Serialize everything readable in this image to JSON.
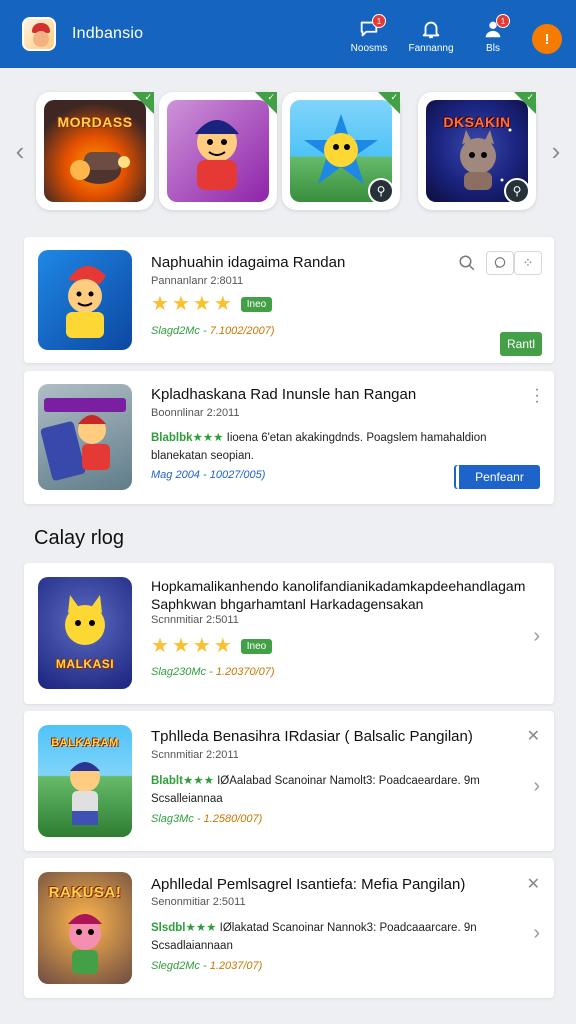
{
  "header": {
    "title": "Indbansio",
    "actions": [
      {
        "label": "Noosms",
        "icon": "chat-icon",
        "badge": "1"
      },
      {
        "label": "Fannanng",
        "icon": "bell-icon",
        "badge": ""
      },
      {
        "label": "Bls",
        "icon": "person-icon",
        "badge": "1"
      }
    ],
    "profile_initial": "!"
  },
  "carousel": {
    "items": [
      {
        "title": "MORDASS",
        "icon": "game-art-icon"
      },
      {
        "title": "",
        "icon": "pirate-character-icon"
      },
      {
        "title": "",
        "icon": "star-character-icon"
      },
      {
        "title": "DKSAKIN",
        "icon": "space-cat-icon"
      }
    ]
  },
  "top_cards": [
    {
      "title": "Naphuahin idagaima Randan",
      "subtitle": "Pannanlanr 2:8011",
      "rating_badge": "Ineo",
      "meta_prefix": "Slagd2Mc",
      "meta_sep": " - ",
      "meta_value": "7.1002/2007)",
      "action_label": "Rantl"
    },
    {
      "title": "Kpladhaskana Rad Inunsle han Rangan",
      "subtitle": "Boonnlinar 2:2011",
      "desc_prefix": "Blablbk★★★",
      "desc_line1": " Iioena 6'etan akakingdnds. Poagslem hamahaldion",
      "desc_line2": "blanekatan seopian.",
      "meta_prefix": "Mag 2004",
      "meta_sep": " - ",
      "meta_value": "10027/005)",
      "action_label": "Penfeanr"
    }
  ],
  "section": {
    "title": "Calay rlog"
  },
  "list_cards": [
    {
      "title": "Hopkamalikanhendo kanolifandianikadamkapdeehandlagam",
      "title2": "Saphkwan bhgarhamtanl Harkadagensakan",
      "subtitle": "Scnnmitiar 2:5011",
      "rating_badge": "Ineo",
      "meta_prefix": "Slag230Mc",
      "meta_sep": " - ",
      "meta_value": "1.20370/07)",
      "art_title": "MALKASI"
    },
    {
      "title": "Tphlleda Benasihra IRdasiar ( Balsalic Pangilan)",
      "subtitle": "Scnnmitiar 2:2011",
      "desc_prefix": "Blablt★★★",
      "desc_line1": " IØAalabad Scanoinar Namolt3: Poadcaeardare. 9m",
      "desc_line2": "Scsalleiannaa",
      "meta_prefix": "Slag3Mc",
      "meta_sep": " - ",
      "meta_value": "1.2580/007)",
      "art_title": "BALKARAM"
    },
    {
      "title": "Aphlledal Pemlsagrel Isantiefa: Mefia Pangilan)",
      "subtitle": "Senonmitiar 2:5011",
      "desc_prefix": "Slsdbl★★★",
      "desc_line1": " IØlakatad Scanoinar Nannok3: Poadcaaarcare. 9n",
      "desc_line2": "Scsadlaiannaan",
      "meta_prefix": "Slegd2Mc",
      "meta_sep": " - ",
      "meta_value": "1.2037/07)",
      "art_title": "RAKUSA!"
    }
  ],
  "colors": {
    "primary": "#1565c0",
    "accent_green": "#43a047",
    "accent_blue": "#1e63c9",
    "star": "#fbc02d",
    "profile": "#f57c00"
  }
}
